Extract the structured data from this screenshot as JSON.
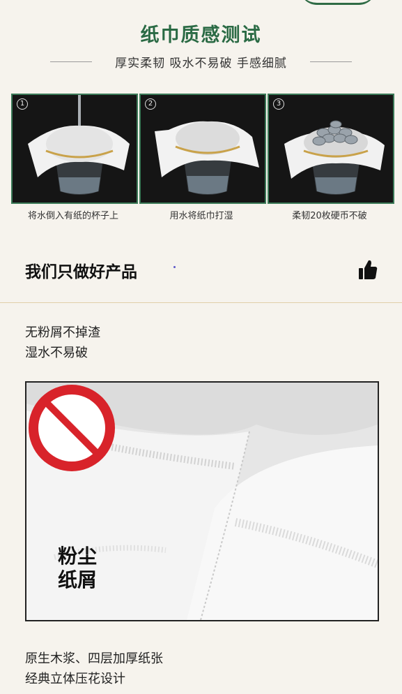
{
  "header": {
    "title": "纸巾质感测试",
    "subtitle": "厚实柔韧  吸水不易破  手感细腻"
  },
  "tests": [
    {
      "num": "1",
      "caption": "将水倒入有纸的杯子上"
    },
    {
      "num": "2",
      "caption": "用水将纸巾打湿"
    },
    {
      "num": "3",
      "caption": "柔韧20枚硬币不破"
    }
  ],
  "section": {
    "title": "我们只做好产品",
    "icon": "thumbs-up-icon"
  },
  "features_top": [
    "无粉屑不掉渣",
    "湿水不易破"
  ],
  "badge": {
    "line1": "粉尘",
    "line2": "纸屑",
    "icon": "prohibited-icon",
    "color": "#d8232a"
  },
  "features_bottom": [
    "原生木浆、四层加厚纸张",
    "经典立体压花设计"
  ],
  "colors": {
    "accent": "#2a6a44",
    "background": "#f6f3ed"
  }
}
